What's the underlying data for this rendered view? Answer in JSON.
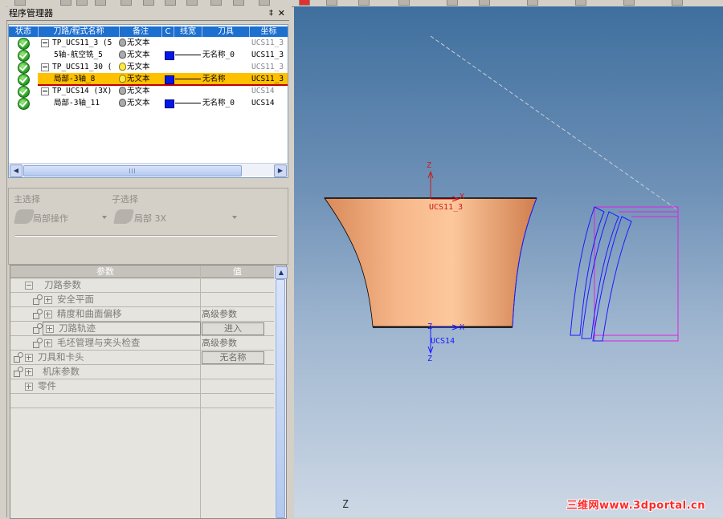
{
  "program_manager": {
    "title": "程序管理器",
    "pin_glyph": "‡",
    "close_glyph": "✕",
    "columns": [
      "状态",
      "刀路/程式名称",
      "备注",
      "C",
      "线宽",
      "刀具",
      "坐标"
    ],
    "rows": [
      {
        "name": "TP_UCS11_3 (5",
        "note": "无文本",
        "tool": "",
        "ucs": "UCS11_3",
        "kind": "group"
      },
      {
        "name": "5轴-航空铣_5",
        "note": "无文本",
        "tool": "无名称_0",
        "ucs": "UCS11_3",
        "kind": "op"
      },
      {
        "name": "TP_UCS11_30 (",
        "note": "无文本",
        "tool": "",
        "ucs": "UCS11_3",
        "kind": "group"
      },
      {
        "name": "局部-3轴_8",
        "note": "无文本",
        "tool": "无名称",
        "ucs": "UCS11_3",
        "kind": "op-selected"
      },
      {
        "name": "TP_UCS14 (3X)",
        "note": "无文本",
        "tool": "",
        "ucs": "UCS14",
        "kind": "group"
      },
      {
        "name": "局部-3轴_11",
        "note": "无文本",
        "tool": "无名称_0",
        "ucs": "UCS14",
        "kind": "op"
      }
    ]
  },
  "selection": {
    "main_label": "主选择",
    "sub_label": "子选择",
    "main_value": "局部操作",
    "sub_value": "局部 3X"
  },
  "params": {
    "header_param": "参数",
    "header_value": "值",
    "rows": [
      {
        "label": "刀路参数",
        "value": "",
        "indent": 1,
        "icon": false,
        "button": false
      },
      {
        "label": "安全平面",
        "value": "",
        "indent": 2,
        "icon": true,
        "button": false
      },
      {
        "label": "精度和曲面偏移",
        "value": "高级参数",
        "indent": 2,
        "icon": true,
        "button": false
      },
      {
        "label": "刀路轨迹",
        "value": "进入",
        "indent": 2,
        "icon": true,
        "button": true
      },
      {
        "label": "毛坯管理与夹头检查",
        "value": "高级参数",
        "indent": 2,
        "icon": true,
        "button": false
      },
      {
        "label": "刀具和卡头",
        "value": "无名称",
        "indent": 0,
        "icon": true,
        "button": true
      },
      {
        "label": "机床参数",
        "value": "",
        "indent": 0,
        "icon": true,
        "button": false
      },
      {
        "label": "零件",
        "value": "",
        "indent": 1,
        "icon": false,
        "button": false
      }
    ]
  },
  "viewport": {
    "ucs_top": "UCS11_3",
    "ucs_bottom": "UCS14",
    "axis_z": "Z",
    "axis_x": "X",
    "corner_z": "Z",
    "watermark": "三维网www.3dportal.cn"
  },
  "colors": {
    "selected_row": "#ffc000",
    "header_blue": "#1d6fd0",
    "part_fill": "#f4a878",
    "toolpath": "#1a1aff",
    "toolpath_frame": "#e020e0"
  }
}
